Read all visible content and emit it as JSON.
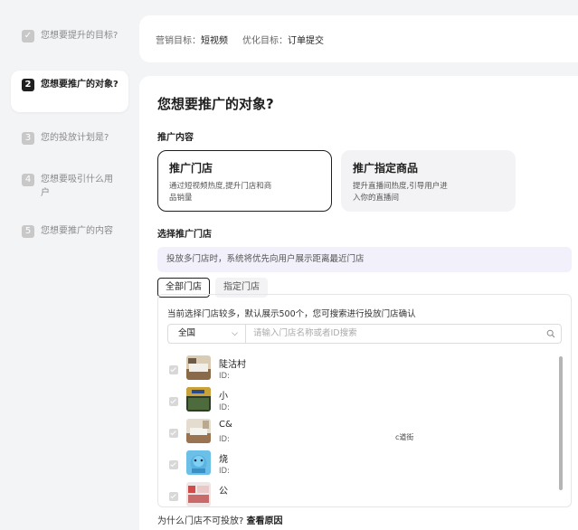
{
  "sidebar": {
    "steps": [
      {
        "num": "✓",
        "label": "您想要提升的目标?"
      },
      {
        "num": "2",
        "label": "您想要推广的对象?"
      },
      {
        "num": "3",
        "label": "您的投放计划是?"
      },
      {
        "num": "4",
        "label": "您想要吸引什么用户"
      },
      {
        "num": "5",
        "label": "您想要推广的内容"
      }
    ]
  },
  "top": {
    "marketing_key": "营销目标：",
    "marketing_val": "短视频",
    "optimize_key": "优化目标：",
    "optimize_val": "订单提交"
  },
  "main": {
    "title": "您想要推广的对象?",
    "content_label": "推广内容",
    "options": [
      {
        "title": "推广门店",
        "desc": "通过短视频热度,提升门店和商品销量"
      },
      {
        "title": "推广指定商品",
        "desc": "提升直播间热度,引导用户进入你的直播间"
      }
    ],
    "select_label": "选择推广门店",
    "tip": "投放多门店时，系统将优先向用户展示距离最近门店",
    "tabs": [
      "全部门店",
      "指定门店"
    ],
    "store_note": "当前选择门店较多，默认展示500个，您可搜索进行投放门店确认",
    "region": "全国",
    "search_placeholder": "请输入门店名称或者ID搜索",
    "stores": [
      {
        "name": "陡沽村",
        "id": "ID:"
      },
      {
        "name": "小",
        "id": "ID:"
      },
      {
        "name": "C&",
        "id": "ID:"
      },
      {
        "name": "烧",
        "id": "ID:"
      },
      {
        "name": "公",
        "id": ""
      }
    ],
    "address_fragment": "c道街",
    "footer_q": "为什么门店不可投放?",
    "footer_link": "查看原因"
  },
  "colors": {
    "accent": "#1f1f1f",
    "tip_bg": "#f1f0fb",
    "unselected_bg": "#f3f3f5"
  }
}
